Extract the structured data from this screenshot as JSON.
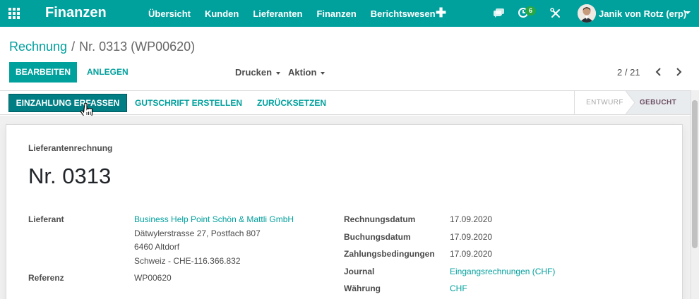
{
  "app": {
    "title": "Finanzen",
    "menu": [
      "Übersicht",
      "Kunden",
      "Lieferanten",
      "Finanzen",
      "Berichtswesen"
    ],
    "activity_count": "6",
    "user_name": "Janik von Rotz (erp)",
    "accent_color": "#00a09d"
  },
  "breadcrumb": {
    "parent": "Rechnung",
    "separator": "/",
    "current": "Nr. 0313 (WP00620)"
  },
  "toolbar": {
    "edit_label": "BEARBEITEN",
    "create_label": "ANLEGEN",
    "print_label": "Drucken",
    "action_label": "Aktion",
    "pager": "2 / 21"
  },
  "statusbar": {
    "register_payment": "EINZAHLUNG ERFASSEN",
    "add_credit_note": "GUTSCHRIFT ERSTELLEN",
    "reset": "ZURÜCKSETZEN",
    "stages": [
      "ENTWURF",
      "GEBUCHT"
    ],
    "current_stage": "GEBUCHT"
  },
  "form": {
    "document_type": "Lieferantenrechnung",
    "number": "Nr. 0313",
    "vendor_label": "Lieferant",
    "vendor_name": "Business Help Point Schön & Mattli GmbH",
    "vendor_address": [
      "Dätwylerstrasse 27, Postfach 807",
      "6460 Altdorf",
      "Schweiz - CHE-116.366.832"
    ],
    "reference_label": "Referenz",
    "reference_value": "WP00620",
    "invoice_date_label": "Rechnungsdatum",
    "invoice_date": "17.09.2020",
    "accounting_date_label": "Buchungsdatum",
    "accounting_date": "17.09.2020",
    "payment_terms_label": "Zahlungsbedingungen",
    "payment_terms": "17.09.2020",
    "journal_label": "Journal",
    "journal_value": "Eingangsrechnungen (CHF)",
    "currency_label": "Währung",
    "currency_value": "CHF"
  },
  "icons": [
    "apps-icon",
    "plus-icon",
    "chat-icon",
    "activity-icon",
    "debug-tools-icon",
    "avatar",
    "chevron-left-icon",
    "chevron-right-icon",
    "hand-pointer-cursor"
  ]
}
